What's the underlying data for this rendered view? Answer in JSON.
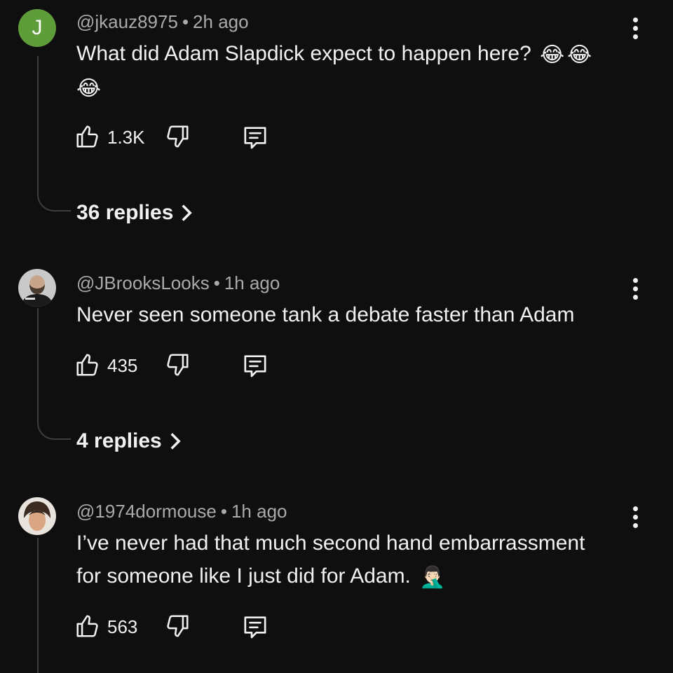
{
  "comments": [
    {
      "avatar_letter": "J",
      "avatar_color": "#5e9d3a",
      "author": "@jkauz8975",
      "time": "2h ago",
      "text_line1": "What did Adam Slapdick expect to happen here?",
      "emoji": "😂",
      "likes": "1.3K",
      "replies": "36 replies"
    },
    {
      "author": "@JBrooksLooks",
      "time": "1h ago",
      "text_line1": "Never seen someone tank a debate faster than Adam",
      "likes": "435",
      "replies": "4 replies"
    },
    {
      "author": "@1974dormouse",
      "time": "1h ago",
      "text_line1": "I’ve never had that much second hand embarrassment",
      "text_line2": "for someone like I just did for Adam.",
      "emoji": "🤦🏻‍♂️",
      "likes": "563"
    }
  ],
  "separator": "•",
  "icons": [
    "thumbs-up-icon",
    "thumbs-down-icon",
    "reply-icon",
    "more-vert-icon",
    "chevron-right-icon"
  ]
}
